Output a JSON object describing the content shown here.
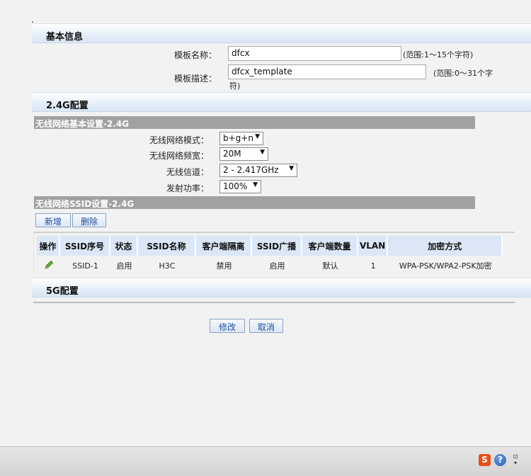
{
  "sections": {
    "basic": "基本信息",
    "g24": "2.4G配置",
    "g5": "5G配置"
  },
  "basic": {
    "name_label": "模板名称：",
    "name_value": "dfcx",
    "name_hint": "(范围:1～15个字符)",
    "desc_label": "模板描述：",
    "desc_value": "dfcx_template",
    "desc_hint_1": "(范围:0～31个字",
    "desc_hint_2": "符)"
  },
  "wireless_basic": {
    "bar_title": "无线网络基本设置-2.4G",
    "mode_label": "无线网络模式：",
    "mode_value": "b+g+n",
    "bandwidth_label": "无线网络频宽：",
    "bandwidth_value": "20M",
    "channel_label": "无线信道：",
    "channel_value": "2 - 2.417GHz",
    "power_label": "发射功率：",
    "power_value": "100%"
  },
  "ssid_settings": {
    "bar_title": "无线网络SSID设置-2.4G",
    "add_button": "新增",
    "delete_button": "删除",
    "columns": [
      "操作",
      "SSID序号",
      "状态",
      "SSID名称",
      "客户端隔离",
      "SSID广播",
      "客户端数量",
      "VLAN",
      "加密方式"
    ],
    "rows": [
      {
        "edit_icon": "pencil-icon",
        "ssid_no": "SSID-1",
        "status": "启用",
        "ssid_name": "H3C",
        "client_isolation": "禁用",
        "ssid_broadcast": "启用",
        "client_count": "默认",
        "vlan": "1",
        "encryption": "WPA-PSK/WPA2-PSK加密"
      }
    ]
  },
  "actions": {
    "modify": "修改",
    "cancel": "取消"
  },
  "colors": {
    "section_bg": "#dce8f5",
    "gray_bar": "#a1a1a1",
    "header_cell": "#dbe7f6",
    "button_text": "#1d4fa0",
    "tray_s_icon": "#e8501a",
    "tray_help_icon": "#2a5db0"
  }
}
